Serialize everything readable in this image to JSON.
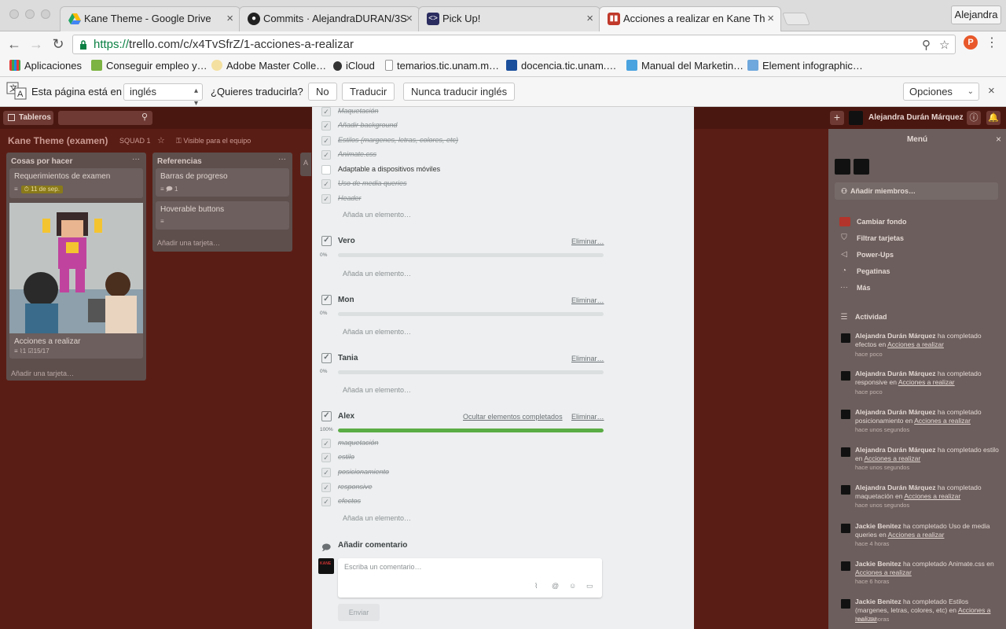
{
  "browser": {
    "tabs": [
      {
        "title": "Kane Theme - Google Drive",
        "icon": "google-drive-icon",
        "color": "#1fa463"
      },
      {
        "title": "Commits · AlejandraDURAN/3S",
        "icon": "github-icon",
        "color": "#222222"
      },
      {
        "title": "Pick Up!",
        "icon": "codepen-icon",
        "color": "#2b2d60"
      },
      {
        "title": "Acciones a realizar en Kane Th",
        "icon": "trello-icon",
        "color": "#c0392b"
      }
    ],
    "profile_name": "Alejandra",
    "url_scheme": "https://",
    "url_rest": "trello.com/c/x4TvSfrZ/1-acciones-a-realizar",
    "bookmarks": [
      {
        "label": "Aplicaciones",
        "icon": "apps-grid-icon"
      },
      {
        "label": "Conseguir empleo y…",
        "icon": "bookmark-green-icon"
      },
      {
        "label": "Adobe Master Colle…",
        "icon": "adobe-icon"
      },
      {
        "label": "iCloud",
        "icon": "apple-icon"
      },
      {
        "label": "temarios.tic.unam.m…",
        "icon": "page-icon"
      },
      {
        "label": "docencia.tic.unam.…",
        "icon": "unam-icon"
      },
      {
        "label": "Manual del Marketin…",
        "icon": "manual-icon"
      },
      {
        "label": "Element infographic…",
        "icon": "image-icon"
      }
    ]
  },
  "translate_bar": {
    "prefix": "Esta página está en",
    "language": "inglés",
    "question": "¿Quieres traducirla?",
    "no": "No",
    "translate": "Traducir",
    "never": "Nunca traducir inglés",
    "options": "Opciones"
  },
  "board": {
    "boards_button": "Tableros",
    "title": "Kane Theme (examen)",
    "team": "SQUAD 1",
    "visibility": "Visible para el equipo",
    "user_name": "Alejandra Durán Márquez",
    "lists": [
      {
        "title": "Cosas por hacer",
        "card1": "Requerimientos de examen",
        "card1_due": "11 de sep.",
        "card2": "Acciones a realizar",
        "card2_attach": "1",
        "card2_checks": "15/17",
        "add": "Añadir una tarjeta…"
      },
      {
        "title": "Referencias",
        "card1": "Barras de progreso",
        "card1_comments": "1",
        "card2": "Hoverable buttons",
        "add": "Añadir una tarjeta…"
      }
    ],
    "third_list_stub": "A"
  },
  "sidebar": {
    "title": "Menú",
    "add_members": "Añadir miembros…",
    "menu": [
      "Cambiar fondo",
      "Filtrar tarjetas",
      "Power-Ups",
      "Pegatinas",
      "Más"
    ],
    "activity_title": "Actividad",
    "activity": [
      {
        "user": "Alejandra Durán Márquez",
        "action": " ha completado efectos en ",
        "card": "Acciones a realizar",
        "when": "hace poco"
      },
      {
        "user": "Alejandra Durán Márquez",
        "action": " ha completado responsive en ",
        "card": "Acciones a realizar",
        "when": "hace poco"
      },
      {
        "user": "Alejandra Durán Márquez",
        "action": " ha completado posicionamiento en ",
        "card": "Acciones a realizar",
        "when": "hace unos segundos"
      },
      {
        "user": "Alejandra Durán Márquez",
        "action": " ha completado estilo en ",
        "card": "Acciones a realizar",
        "when": "hace unos segundos"
      },
      {
        "user": "Alejandra Durán Márquez",
        "action": " ha completado maquetación en ",
        "card": "Acciones a realizar",
        "when": "hace unos segundos"
      },
      {
        "user": "Jackie Benitez",
        "action": " ha completado Uso de media queries en ",
        "card": "Acciones a realizar",
        "when": "hace 4 horas"
      },
      {
        "user": "Jackie Benitez",
        "action": " ha completado Animate.css en ",
        "card": "Acciones a realizar",
        "when": "hace 6 horas"
      },
      {
        "user": "Jackie Benitez",
        "action": " ha completado Estilos (margenes, letras, colores, etc) en ",
        "card": "Acciones a realizar",
        "when": "hace 6 horas"
      }
    ]
  },
  "modal": {
    "top_items": [
      {
        "text": "Maquetación",
        "done": true
      },
      {
        "text": "Añadir background",
        "done": true
      },
      {
        "text": "Estilos (margenes, letras, colores, etc)",
        "done": true
      },
      {
        "text": "Animate.css",
        "done": true
      },
      {
        "text": "Adaptable a dispositivos móviles",
        "done": false
      },
      {
        "text": "Uso de media queries",
        "done": true
      },
      {
        "text": "Header",
        "done": true
      }
    ],
    "add_item": "Añada un elemento…",
    "checklists": [
      {
        "title": "Vero",
        "progress": 0,
        "pct_label": "0%",
        "delete": "Eliminar…"
      },
      {
        "title": "Mon",
        "progress": 0,
        "pct_label": "0%",
        "delete": "Eliminar…"
      },
      {
        "title": "Tania",
        "progress": 0,
        "pct_label": "0%",
        "delete": "Eliminar…"
      },
      {
        "title": "Alex",
        "progress": 100,
        "pct_label": "100%",
        "delete": "Eliminar…",
        "hide": "Ocultar elementos completados"
      }
    ],
    "alex_items": [
      "maquetación",
      "estilo",
      "posicionamiento",
      "responsive",
      "efectos"
    ],
    "comment_title": "Añadir comentario",
    "comment_placeholder": "Escriba un comentario…",
    "send": "Enviar"
  },
  "colors": {
    "board_bg": "#5a1d15",
    "progress_green": "#5aac44",
    "swatch": "#b3342a"
  }
}
